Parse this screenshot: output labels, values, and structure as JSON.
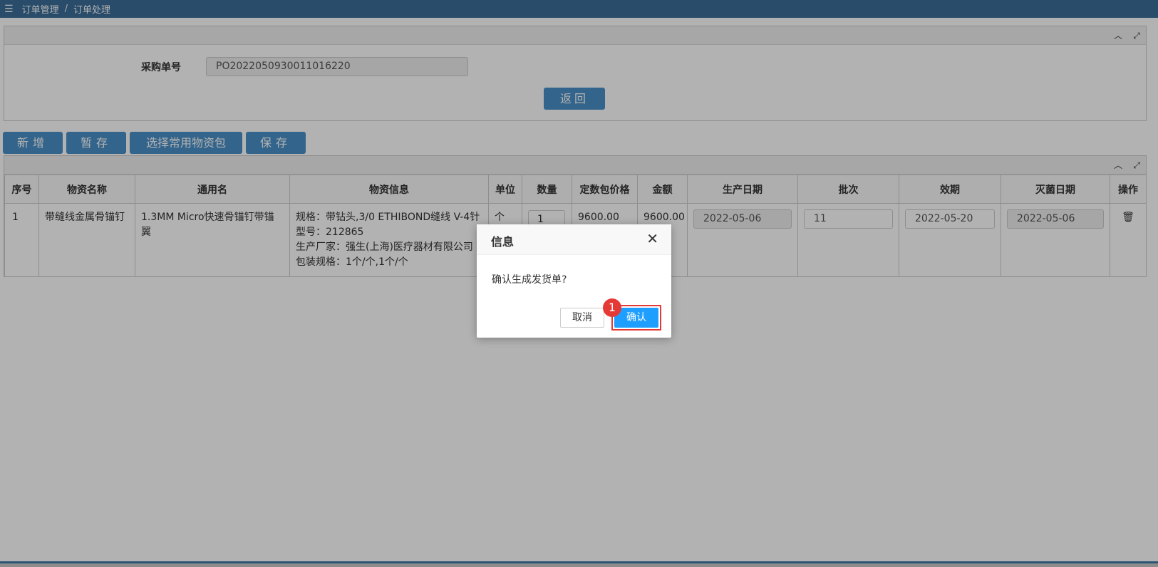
{
  "breadcrumb": {
    "menu_icon": "menu-icon",
    "items": [
      "订单管理",
      "/",
      "订单处理"
    ]
  },
  "search_panel": {
    "label": "采购单号",
    "value": "PO2022050930011016220",
    "return_label": "返回"
  },
  "toolbar": {
    "add_label": "新增",
    "draft_label": "暂存",
    "package_label": "选择常用物资包",
    "save_label": "保存"
  },
  "table": {
    "headers": [
      "序号",
      "物资名称",
      "通用名",
      "物资信息",
      "单位",
      "数量",
      "定数包价格",
      "金额",
      "生产日期",
      "批次",
      "效期",
      "灭菌日期",
      "操作"
    ],
    "rows": [
      {
        "seq": "1",
        "name": "带缝线金属骨锚钉",
        "generic_name": "1.3MM Micro快速骨锚钉带锚翼",
        "info": [
          "规格：带钻头,3/0 ETHIBOND缝线 V-4针",
          "型号：212865",
          "生产厂家：强生(上海)医疗器材有限公司",
          "包装规格：1个/个,1个/个"
        ],
        "unit": "个",
        "quantity": "1",
        "package_price": "9600.00",
        "amount": "9600.00",
        "production_date": "2022-05-06",
        "batch": "11",
        "expiry": "2022-05-20",
        "sterilization_date": "2022-05-06"
      }
    ]
  },
  "dialog": {
    "title": "信息",
    "message": "确认生成发货单?",
    "cancel_label": "取消",
    "confirm_label": "确认",
    "step_badge": "1"
  }
}
